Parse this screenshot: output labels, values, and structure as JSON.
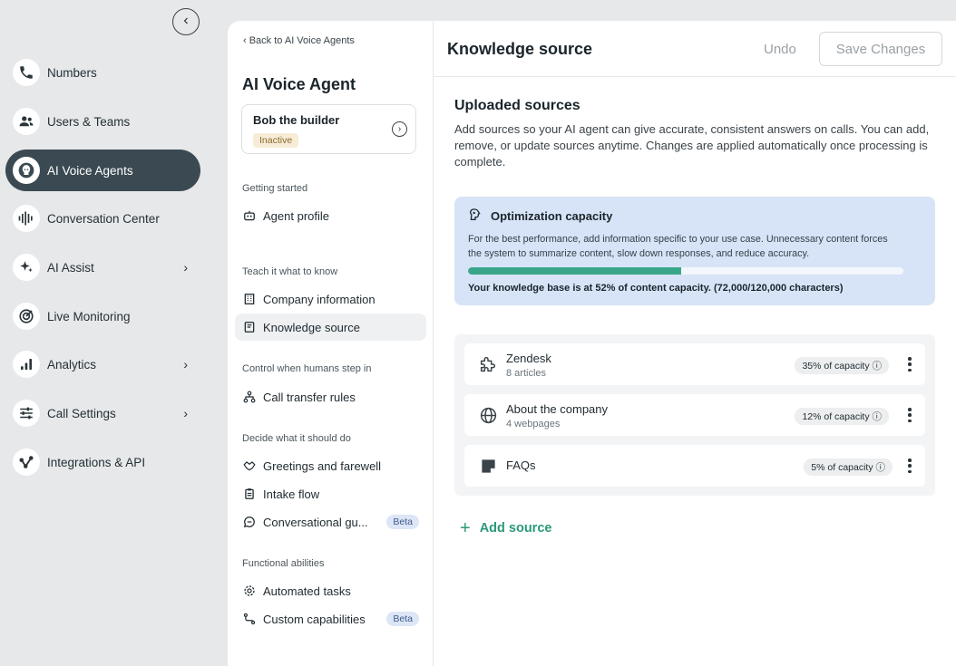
{
  "nav": {
    "items": [
      {
        "label": "Numbers",
        "icon": "phone-icon",
        "chevron": ""
      },
      {
        "label": "Users & Teams",
        "icon": "users-icon",
        "chevron": ""
      },
      {
        "label": "AI Voice Agents",
        "icon": "ai-agent-icon",
        "chevron": "",
        "active": true
      },
      {
        "label": "Conversation Center",
        "icon": "waveform-icon",
        "chevron": ""
      },
      {
        "label": "AI Assist",
        "icon": "sparkle-icon",
        "chevron": "›"
      },
      {
        "label": "Live Monitoring",
        "icon": "monitor-icon",
        "chevron": ""
      },
      {
        "label": "Analytics",
        "icon": "bar-chart-icon",
        "chevron": "›"
      },
      {
        "label": "Call Settings",
        "icon": "sliders-icon",
        "chevron": "›"
      },
      {
        "label": "Integrations & API",
        "icon": "integration-icon",
        "chevron": ""
      }
    ],
    "collapse_glyph": "‹"
  },
  "mid": {
    "back_label": "‹  Back to AI Voice Agents",
    "title": "AI Voice Agent",
    "agent_name": "Bob the builder",
    "agent_status": "Inactive",
    "card_arrow": "›",
    "sections": {
      "getting_started": "Getting started",
      "teach": "Teach it what to know",
      "control": "Control when humans step in",
      "decide": "Decide what it should do",
      "functional": "Functional abilities"
    },
    "items": {
      "agent_profile": "Agent profile",
      "company_info": "Company information",
      "knowledge_source": "Knowledge source",
      "call_transfer": "Call transfer rules",
      "greetings": "Greetings and farewell",
      "intake": "Intake flow",
      "conversational": "Conversational gu...",
      "automated": "Automated tasks",
      "custom": "Custom capabilities"
    },
    "beta_label": "Beta"
  },
  "main": {
    "title": "Knowledge source",
    "undo_label": "Undo",
    "save_label": "Save Changes",
    "uploaded_title": "Uploaded sources",
    "uploaded_desc": "Add sources so your AI agent can give accurate, consistent answers on calls. You can add, remove, or update sources anytime. Changes are applied automatically once processing is complete.",
    "capacity": {
      "title": "Optimization capacity",
      "desc": "For the best performance, add information specific to your use case. Unnecessary content forces the system to summarize content, slow down responses, and reduce accuracy.",
      "footer": "Your knowledge base is at 52% of content capacity. (72,000/120,000 characters)",
      "fill_fraction": 0.49,
      "fill_color": "#3aa58a"
    },
    "sources": [
      {
        "name": "Zendesk",
        "sub": "8 articles",
        "capacity": "35% of capacity  ⓘ",
        "icon": "puzzle-icon"
      },
      {
        "name": "About the company",
        "sub": "4 webpages",
        "capacity": "12% of capacity  ⓘ",
        "icon": "globe-icon"
      },
      {
        "name": "FAQs",
        "sub": "",
        "capacity": "5% of capacity  ⓘ",
        "icon": "note-icon"
      }
    ],
    "add_source_label": "Add source",
    "add_source_glyph": "+"
  }
}
